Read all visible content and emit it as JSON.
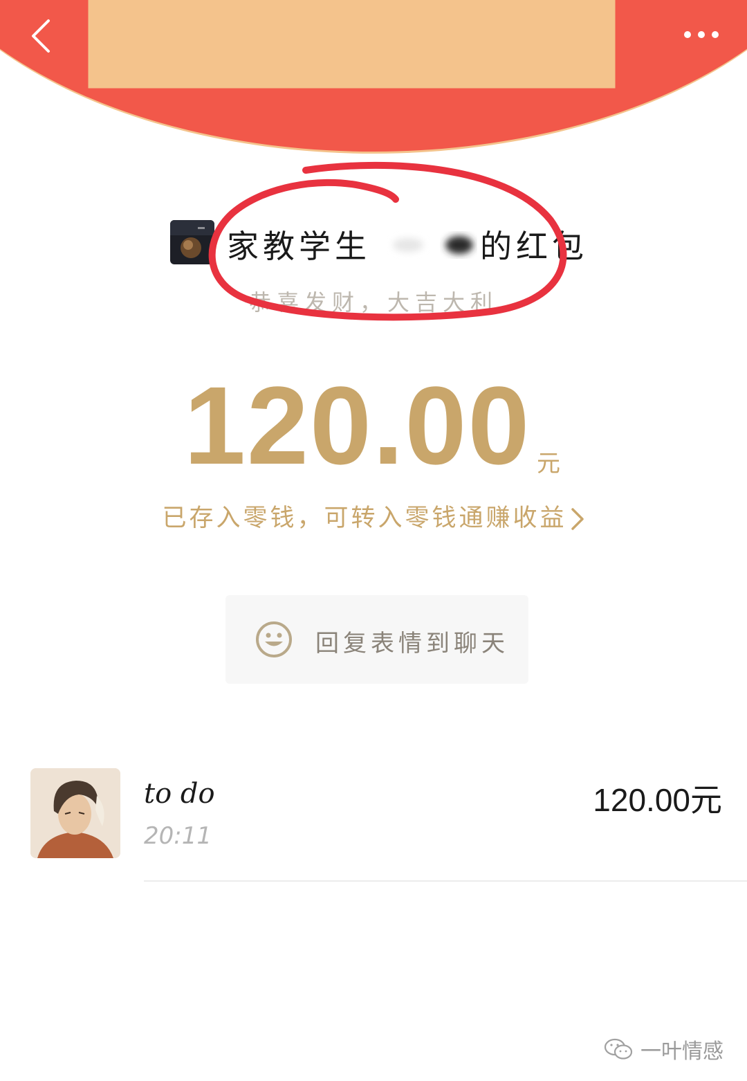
{
  "header": {
    "back_icon": "chevron-left-icon",
    "more_icon": "more-dots-icon",
    "background_color": "#f2584a"
  },
  "sender": {
    "name_visible_start": "家教学生",
    "name_visible_end": "的红包",
    "greeting": "恭喜发财，大吉大利"
  },
  "amount": {
    "value": "120.00",
    "unit": "元",
    "color": "#c9a66b"
  },
  "wallet_link": {
    "label": "已存入零钱，可转入零钱通赚收益"
  },
  "reply": {
    "label": "回复表情到聊天",
    "icon": "smile-icon"
  },
  "receivers": [
    {
      "name": "to do",
      "time": "20:11",
      "amount": "120.00元"
    }
  ],
  "watermark": {
    "text": "一叶情感",
    "icon": "wechat-icon"
  }
}
